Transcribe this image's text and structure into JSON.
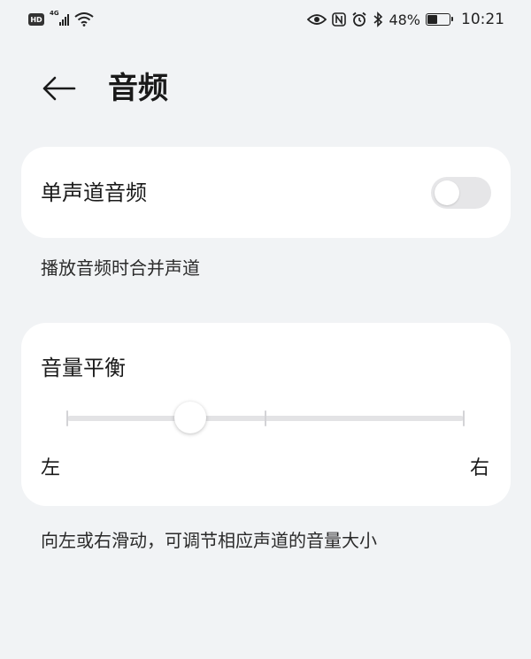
{
  "status_bar": {
    "hd": "HD",
    "network": "4G",
    "battery_percent": "48%",
    "battery_level": 0.48,
    "time": "10:21",
    "icons": [
      "hd-icon",
      "signal-icon",
      "wifi-icon",
      "eye-icon",
      "nfc-icon",
      "alarm-icon",
      "bluetooth-icon",
      "battery-icon"
    ]
  },
  "header": {
    "title": "音频",
    "back_icon": "back-arrow-icon"
  },
  "mono_audio": {
    "label": "单声道音频",
    "enabled": false,
    "description": "播放音频时合并声道"
  },
  "balance": {
    "title": "音量平衡",
    "left_label": "左",
    "right_label": "右",
    "value": 0.31,
    "ticks": [
      0,
      0.5,
      1
    ],
    "description": "向左或右滑动，可调节相应声道的音量大小"
  }
}
